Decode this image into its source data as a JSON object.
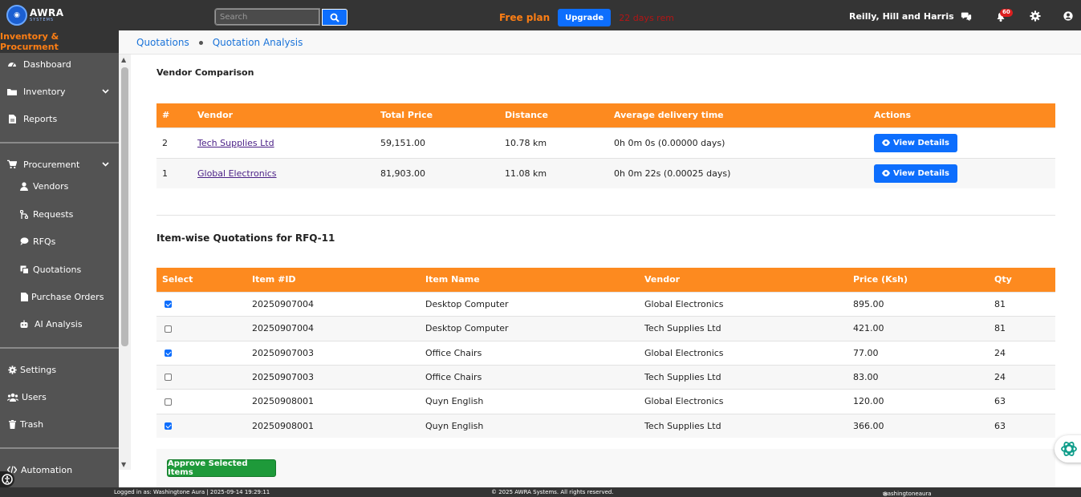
{
  "header": {
    "logo_text": "AWRA",
    "logo_subtext": "SYSTEMS",
    "search_placeholder": "Search",
    "plan_label": "Free plan",
    "upgrade_label": "Upgrade",
    "days_remaining": "22 days rem",
    "company": "Reilly, Hill and Harris",
    "notification_count": "60"
  },
  "sidebar": {
    "title": "Inventory & Procurment",
    "items": [
      {
        "label": "Dashboard",
        "icon": "dashboard-icon"
      },
      {
        "label": "Inventory",
        "icon": "folder-icon"
      },
      {
        "label": "Reports",
        "icon": "file-icon"
      },
      {
        "label": "Procurement",
        "icon": "cart-icon"
      },
      {
        "label": "Vendors",
        "icon": "user-icon"
      },
      {
        "label": "Requests",
        "icon": "branch-icon"
      },
      {
        "label": "RFQs",
        "icon": "chat-icon"
      },
      {
        "label": "Quotations",
        "icon": "copy-icon"
      },
      {
        "label": "Purchase Orders",
        "icon": "file-icon"
      },
      {
        "label": "AI Analysis",
        "icon": "robot-icon"
      },
      {
        "label": "Settings",
        "icon": "gear-icon"
      },
      {
        "label": "Users",
        "icon": "users-icon"
      },
      {
        "label": "Trash",
        "icon": "trash-icon"
      },
      {
        "label": "Automation",
        "icon": "code-icon"
      }
    ]
  },
  "breadcrumb": [
    "Quotations",
    "Quotation Analysis"
  ],
  "vendor_comparison": {
    "title": "Vendor Comparison",
    "columns": [
      "#",
      "Vendor",
      "Total Price",
      "Distance",
      "Average delivery time",
      "Actions"
    ],
    "rows": [
      {
        "rank": "2",
        "vendor": "Tech Supplies Ltd",
        "total": "59,151.00",
        "distance": "10.78 km",
        "delivery": "0h 0m 0s (0.00000 days)",
        "action": "View Details"
      },
      {
        "rank": "1",
        "vendor": "Global Electronics",
        "total": "81,903.00",
        "distance": "11.08 km",
        "delivery": "0h 0m 22s (0.00025 days)",
        "action": "View Details"
      }
    ]
  },
  "itemwise": {
    "title": "Item-wise Quotations for RFQ-11",
    "columns": [
      "Select",
      "Item #ID",
      "Item Name",
      "Vendor",
      "Price (Ksh)",
      "Qty"
    ],
    "rows": [
      {
        "selected": true,
        "id": "20250907004",
        "name": "Desktop Computer",
        "vendor": "Global Electronics",
        "price": "895.00",
        "qty": "81"
      },
      {
        "selected": false,
        "id": "20250907004",
        "name": "Desktop Computer",
        "vendor": "Tech Supplies Ltd",
        "price": "421.00",
        "qty": "81"
      },
      {
        "selected": true,
        "id": "20250907003",
        "name": "Office Chairs",
        "vendor": "Global Electronics",
        "price": "77.00",
        "qty": "24"
      },
      {
        "selected": false,
        "id": "20250907003",
        "name": "Office Chairs",
        "vendor": "Tech Supplies Ltd",
        "price": "83.00",
        "qty": "24"
      },
      {
        "selected": false,
        "id": "20250908001",
        "name": "Quyn English",
        "vendor": "Global Electronics",
        "price": "120.00",
        "qty": "63"
      },
      {
        "selected": true,
        "id": "20250908001",
        "name": "Quyn English",
        "vendor": "Tech Supplies Ltd",
        "price": "366.00",
        "qty": "63"
      }
    ],
    "approve_label": "Approve Selected Items"
  },
  "footer": {
    "logged_in": "Logged in as: Washingtone Aura | 2025-09-14 19:29:11",
    "copyright": "© 2025 AWRA Systems. All rights reserved.",
    "handle": "washingtoneaura"
  },
  "colors": {
    "topbar": "#343434",
    "sidebar": "#535353",
    "accent_orange": "#fd8a1f",
    "primary_blue": "#0d6efd",
    "success_green": "#1e9a3a"
  }
}
